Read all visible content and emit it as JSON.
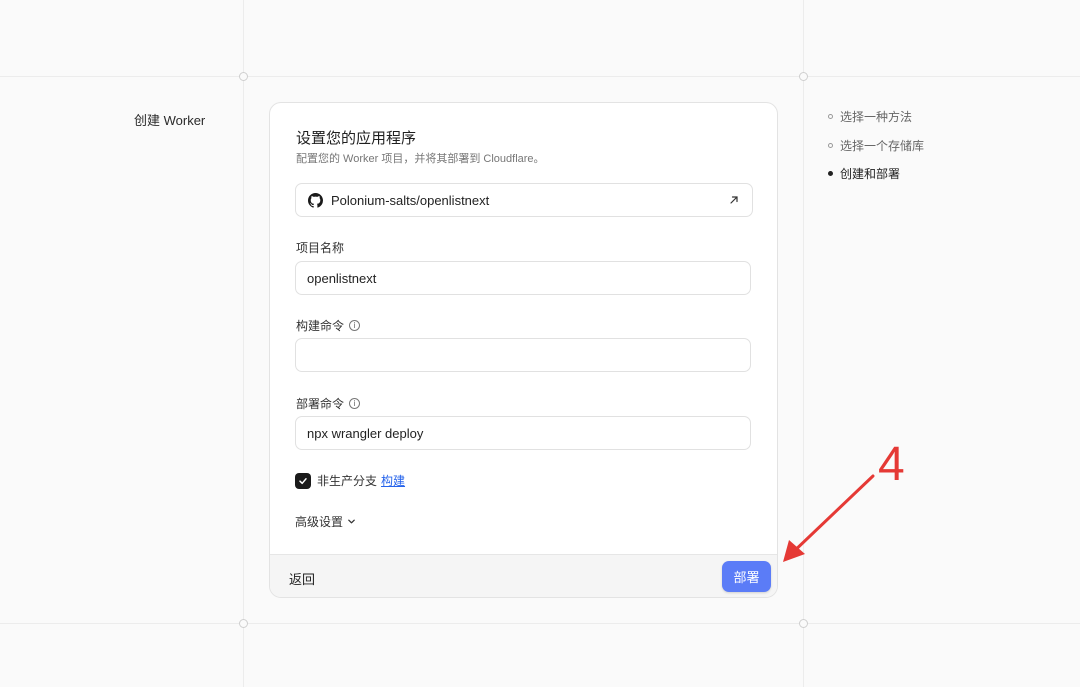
{
  "page": {
    "section_title": "创建 Worker"
  },
  "card": {
    "title": "设置您的应用程序",
    "subtitle": "配置您的 Worker 项目，并将其部署到 Cloudflare。",
    "repo": {
      "name": "Polonium-salts/openlistnext",
      "icon": "github-icon",
      "link_icon": "external-link-icon"
    },
    "fields": {
      "project_name": {
        "label": "项目名称",
        "value": "openlistnext"
      },
      "build_command": {
        "label": "构建命令",
        "value": ""
      },
      "deploy_command": {
        "label": "部署命令",
        "value": "npx wrangler deploy"
      }
    },
    "non_production": {
      "label": "非生产分支",
      "link": "构建",
      "checked": true
    },
    "advanced": {
      "label": "高级设置"
    },
    "footer": {
      "back_label": "返回",
      "deploy_label": "部署"
    }
  },
  "steps": [
    {
      "label": "选择一种方法",
      "active": false
    },
    {
      "label": "选择一个存储库",
      "active": false
    },
    {
      "label": "创建和部署",
      "active": true
    }
  ],
  "annotation": {
    "number": "4",
    "color": "#e53935"
  },
  "colors": {
    "accent": "#5b7cf7",
    "link": "#2563eb"
  }
}
